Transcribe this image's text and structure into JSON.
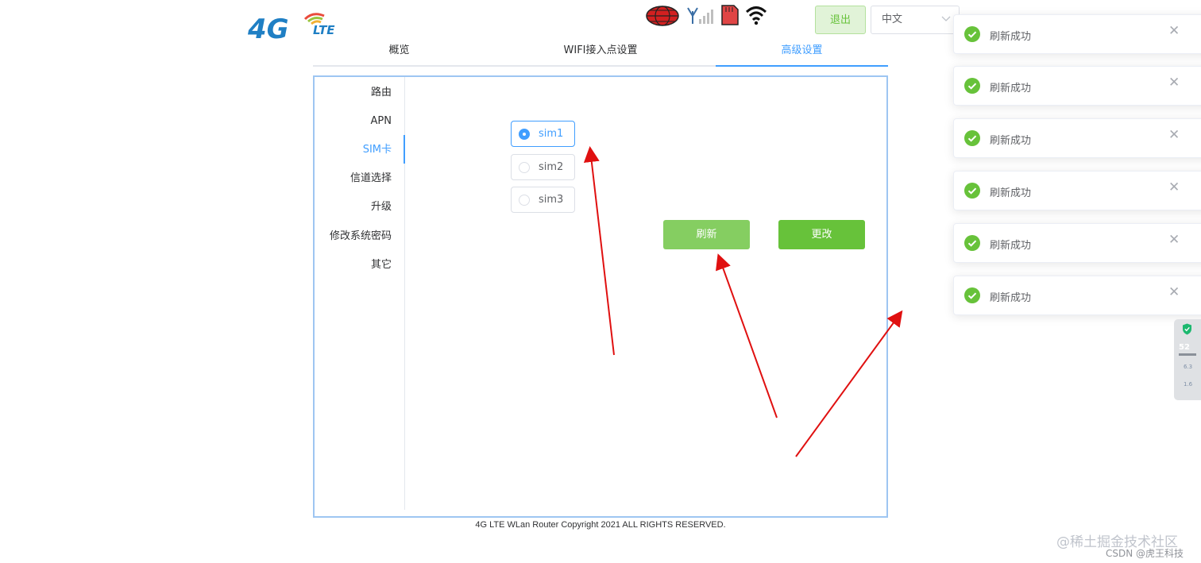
{
  "brand": {
    "logo_text": "4G LTE"
  },
  "header": {
    "status_icons": [
      "globe-icon",
      "signal-icon",
      "sim-card-icon",
      "wifi-icon"
    ],
    "logout_label": "退出",
    "language_value": "中文"
  },
  "tabs": [
    {
      "label": "概览",
      "active": false
    },
    {
      "label": "WIFI接入点设置",
      "active": false
    },
    {
      "label": "高级设置",
      "active": true
    }
  ],
  "menu": [
    {
      "label": "路由",
      "active": false
    },
    {
      "label": "APN",
      "active": false
    },
    {
      "label": "SIM卡",
      "active": true
    },
    {
      "label": "信道选择",
      "active": false
    },
    {
      "label": "升级",
      "active": false
    },
    {
      "label": "修改系统密码",
      "active": false
    },
    {
      "label": "其它",
      "active": false
    }
  ],
  "sim_options": [
    {
      "label": "sim1",
      "checked": true
    },
    {
      "label": "sim2",
      "checked": false
    },
    {
      "label": "sim3",
      "checked": false
    }
  ],
  "buttons": {
    "refresh": "刷新",
    "change": "更改"
  },
  "footer": "4G LTE WLan Router Copyright 2021 ALL RIGHTS RESERVED.",
  "notifications": [
    {
      "text": "刷新成功"
    },
    {
      "text": "刷新成功"
    },
    {
      "text": "刷新成功"
    },
    {
      "text": "刷新成功"
    },
    {
      "text": "刷新成功"
    },
    {
      "text": "刷新成功"
    }
  ],
  "side_widget": {
    "percent": "52",
    "up_speed": "6.3",
    "down_speed": "1.6"
  },
  "watermarks": {
    "line1": "@稀土掘金技术社区",
    "line2": "CSDN @虎王科技"
  },
  "colors": {
    "primary": "#409eff",
    "success": "#67c23a",
    "annotation_arrow": "#e01010"
  }
}
